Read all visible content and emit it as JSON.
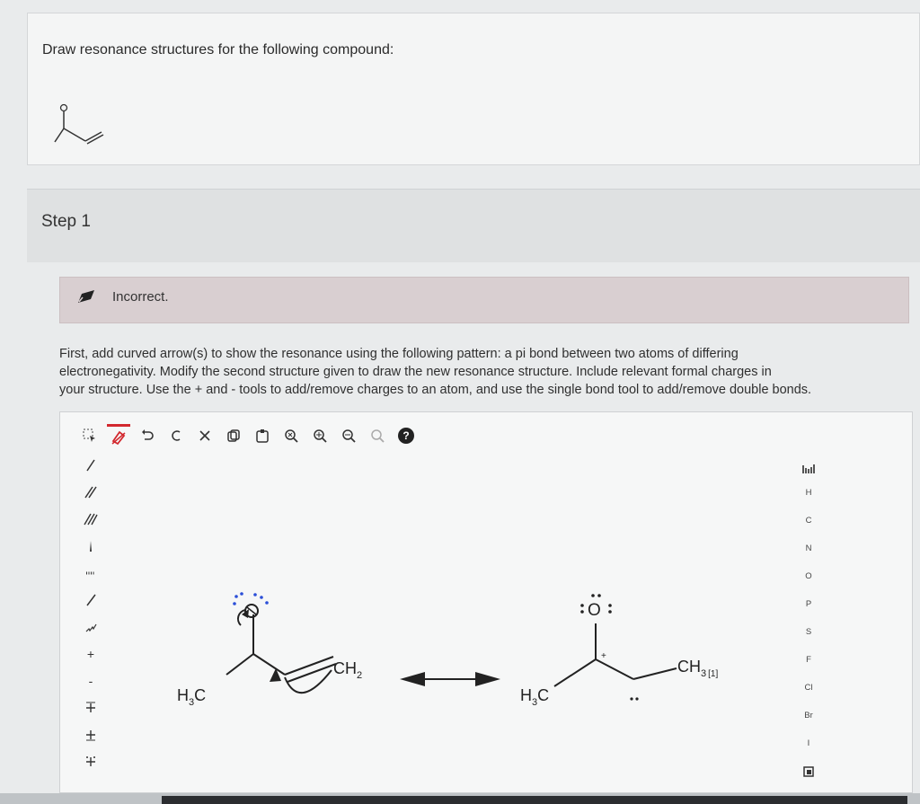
{
  "question": {
    "text": "Draw resonance structures for the following compound:"
  },
  "step": {
    "title": "Step 1"
  },
  "feedback": {
    "status": "Incorrect.",
    "icon": "pencil-icon"
  },
  "instructions": {
    "line1": "First, add curved arrow(s) to show the resonance using the following pattern: a pi bond between two atoms of differing",
    "line2": "electronegativity. Modify the second structure given to draw the new resonance structure. Include relevant formal charges in",
    "line3": "your structure. Use the + and - tools to add/remove charges to an atom, and use the single bond tool to add/remove double bonds."
  },
  "toolbar": {
    "tools": [
      "select-tool",
      "erase-tool",
      "undo",
      "redo",
      "clear",
      "copy",
      "paste",
      "zoom-fit",
      "zoom-in",
      "zoom-out",
      "zoom-reset",
      "help"
    ],
    "help_label": "?"
  },
  "left_tools": {
    "plus_label": "+",
    "minus_label": "-"
  },
  "elements": [
    "H",
    "C",
    "N",
    "O",
    "P",
    "S",
    "F",
    "Cl",
    "Br",
    "I"
  ],
  "structure1": {
    "h3c_main": "H",
    "h3c_sub": "3",
    "h3c_tail": "C",
    "ch2_main": "CH",
    "ch2_sub": "2"
  },
  "structure2": {
    "h3c_main": "H",
    "h3c_sub": "3",
    "h3c_tail": "C",
    "ch3_main": "CH",
    "ch3_sub": "3",
    "marker": "[1]",
    "oxygen": "O",
    "plus_charge": "+"
  },
  "colors": {
    "accent_red": "#d2282e",
    "feedback_bg": "#d9cfd1",
    "lone_pair_blue": "#2b4fd8"
  }
}
